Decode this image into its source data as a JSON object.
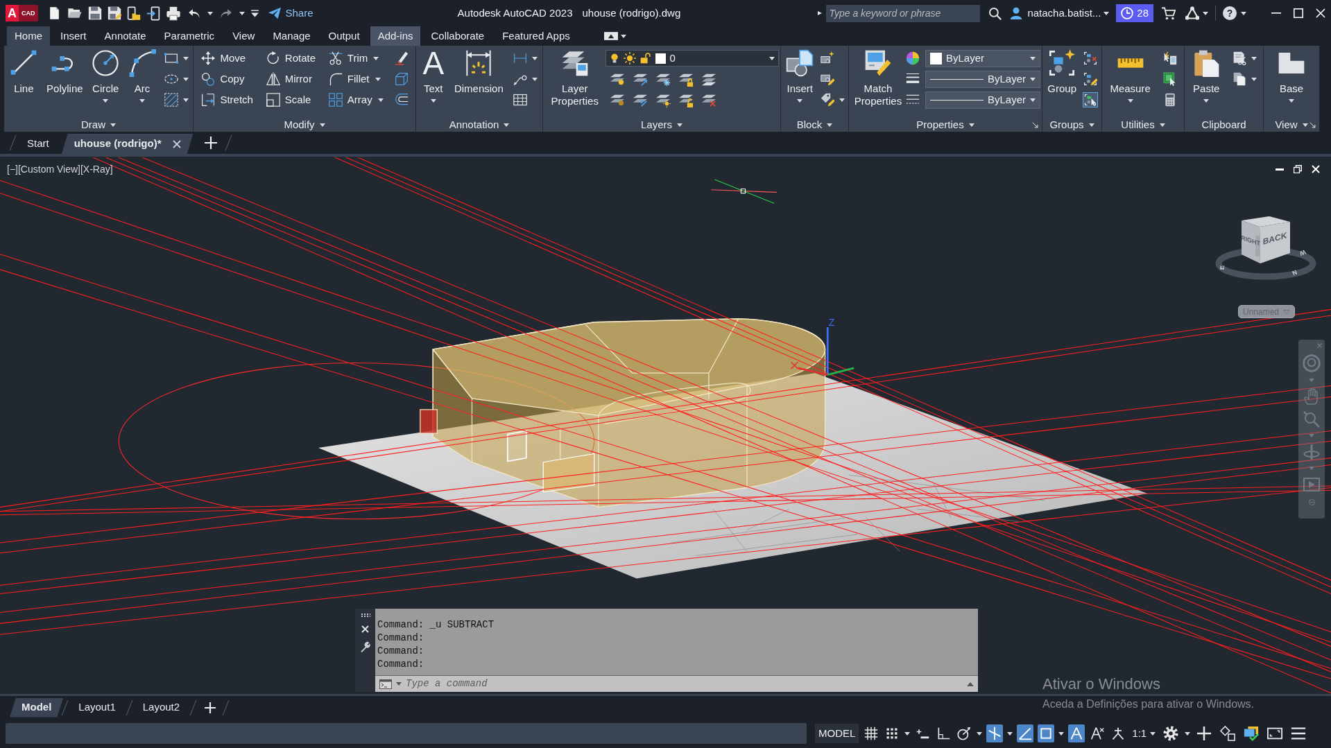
{
  "title_bar": {
    "logo": {
      "letter": "A",
      "text": "CAD"
    },
    "share": "Share",
    "title": "Autodesk AutoCAD 2023",
    "file": "uhouse (rodrigo).dwg",
    "search": {
      "placeholder": "Type a keyword or phrase"
    },
    "user": "natacha.batist...",
    "badge": "28",
    "help": "?"
  },
  "ribbon": {
    "tabs": [
      {
        "label": "Home",
        "selected": true,
        "highlighted": false
      },
      {
        "label": "Insert",
        "selected": false,
        "highlighted": false
      },
      {
        "label": "Annotate",
        "selected": false,
        "highlighted": false
      },
      {
        "label": "Parametric",
        "selected": false,
        "highlighted": false
      },
      {
        "label": "View",
        "selected": false,
        "highlighted": false
      },
      {
        "label": "Manage",
        "selected": false,
        "highlighted": false
      },
      {
        "label": "Output",
        "selected": false,
        "highlighted": false
      },
      {
        "label": "Add-ins",
        "selected": false,
        "highlighted": true
      },
      {
        "label": "Collaborate",
        "selected": false,
        "highlighted": false
      },
      {
        "label": "Featured Apps",
        "selected": false,
        "highlighted": false
      }
    ],
    "panels": [
      {
        "title": "Draw",
        "menu": true,
        "launcher": false,
        "columns": [
          {
            "kind": "large",
            "label": "Line",
            "dropdown": false
          },
          {
            "kind": "large",
            "label": "Polyline",
            "dropdown": false
          },
          {
            "kind": "large",
            "label": "Circle",
            "dropdown": true
          },
          {
            "kind": "large",
            "label": "Arc",
            "dropdown": true
          },
          {
            "kind": "small",
            "items": [
              {
                "dropdown": true
              },
              {
                "dropdown": true
              },
              {
                "dropdown": true
              }
            ]
          }
        ]
      },
      {
        "title": "Modify",
        "menu": true,
        "launcher": false,
        "columns": [
          {
            "kind": "small",
            "items": [
              {
                "label": "Move",
                "dropdown": false
              },
              {
                "label": "Copy",
                "dropdown": false
              },
              {
                "label": "Stretch",
                "dropdown": false
              }
            ]
          },
          {
            "kind": "small",
            "items": [
              {
                "label": "Rotate",
                "dropdown": false
              },
              {
                "label": "Mirror",
                "dropdown": false
              },
              {
                "label": "Scale",
                "dropdown": false
              }
            ]
          },
          {
            "kind": "small",
            "items": [
              {
                "label": "Trim",
                "dropdown": true
              },
              {
                "label": "Fillet",
                "dropdown": true
              },
              {
                "label": "Array",
                "dropdown": true
              }
            ]
          },
          {
            "kind": "small",
            "items": [
              {
                "dropdown": false
              },
              {
                "dropdown": false
              },
              {
                "dropdown": false
              }
            ]
          }
        ]
      },
      {
        "title": "Annotation",
        "menu": true,
        "launcher": false,
        "columns": [
          {
            "kind": "large",
            "label": "Text",
            "glyph": "A",
            "dropdown": true
          },
          {
            "kind": "large",
            "label": "Dimension",
            "dropdown": false
          },
          {
            "kind": "small",
            "items": [
              {
                "dropdown": true
              },
              {
                "dropdown": true
              },
              {
                "dropdown": false
              }
            ]
          }
        ]
      },
      {
        "title": "Layers",
        "menu": true,
        "launcher": false,
        "columns": [
          {
            "kind": "large",
            "label": "Layer Properties",
            "dropdown": false
          },
          {
            "kind": "layers",
            "value": "0"
          }
        ]
      },
      {
        "title": "Block",
        "menu": true,
        "launcher": false,
        "columns": [
          {
            "kind": "large",
            "label": "Insert",
            "dropdown": true
          },
          {
            "kind": "small",
            "items": [
              {
                "dropdown": false
              },
              {
                "dropdown": false
              },
              {
                "dropdown": true
              }
            ]
          }
        ]
      },
      {
        "title": "Properties",
        "menu": true,
        "launcher": true,
        "columns": [
          {
            "kind": "large",
            "label": "Match Properties",
            "dropdown": false
          },
          {
            "kind": "properties",
            "selects": [
              {
                "kind": "color",
                "value": "ByLayer"
              },
              {
                "kind": "line",
                "value": "ByLayer"
              },
              {
                "kind": "line",
                "value": "ByLayer"
              }
            ]
          }
        ]
      },
      {
        "title": "Groups",
        "menu": true,
        "launcher": false,
        "columns": [
          {
            "kind": "large",
            "label": "Group",
            "dropdown": false
          },
          {
            "kind": "small",
            "items": [
              {
                "dropdown": false,
                "on": false
              },
              {
                "dropdown": false,
                "on": false
              },
              {
                "dropdown": false,
                "on": true
              }
            ]
          }
        ]
      },
      {
        "title": "Utilities",
        "menu": true,
        "launcher": false,
        "columns": [
          {
            "kind": "large",
            "label": "Measure",
            "dropdown": true
          },
          {
            "kind": "small",
            "items": [
              {
                "dropdown": false
              },
              {
                "dropdown": false
              },
              {
                "dropdown": false
              }
            ]
          }
        ]
      },
      {
        "title": "Clipboard",
        "menu": false,
        "launcher": false,
        "columns": [
          {
            "kind": "large",
            "label": "Paste",
            "dropdown": true
          },
          {
            "kind": "small",
            "items": [
              {
                "dropdown": true
              },
              {
                "dropdown": true
              }
            ]
          }
        ]
      },
      {
        "title": "View",
        "menu": true,
        "launcher": true,
        "columns": [
          {
            "kind": "large",
            "label": "Base",
            "dropdown": true
          }
        ]
      }
    ]
  },
  "document_tabs": [
    {
      "label": "Start",
      "selected": false,
      "closable": false
    },
    {
      "label": "uhouse (rodrigo)*",
      "selected": true,
      "closable": true
    }
  ],
  "viewport": {
    "controls": [
      "[−]",
      "[Custom View]",
      "[X-Ray]"
    ],
    "viewcube": {
      "faces": [
        "RIGHT",
        "BACK"
      ],
      "compass": [
        "E",
        "N",
        "W"
      ]
    },
    "named_view": "Unnamed",
    "ucs_label": "Z"
  },
  "command_line": {
    "history": [
      "Command: _u SUBTRACT",
      "Command:",
      "Command:",
      "Command:"
    ],
    "placeholder": "Type a command"
  },
  "layout_tabs": [
    {
      "label": "Model",
      "selected": true
    },
    {
      "label": "Layout1",
      "selected": false
    },
    {
      "label": "Layout2",
      "selected": false
    }
  ],
  "windows_notice": {
    "title": "Ativar o Windows",
    "text": "Aceda a Definições para ativar o Windows."
  },
  "status_bar": {
    "space": "MODEL",
    "toggles": [
      {
        "on": false,
        "dropdown": false
      },
      {
        "on": false,
        "dropdown": true
      },
      {
        "on": false,
        "dropdown": false
      },
      {
        "on": false,
        "dropdown": false
      },
      {
        "on": false,
        "dropdown": true
      },
      {
        "on": true,
        "dropdown": true
      },
      {
        "on": true,
        "dropdown": false
      },
      {
        "on": true,
        "dropdown": true
      },
      {
        "on": true,
        "dropdown": false
      },
      {
        "on": false,
        "dropdown": false
      },
      {
        "on": false,
        "dropdown": false
      }
    ],
    "scale": "1:1",
    "buttons": [
      {
        "dropdown": true
      },
      {
        "dropdown": false
      },
      {
        "dropdown": false
      },
      {
        "dropdown": false
      },
      {
        "dropdown": false
      },
      {
        "dropdown": false
      }
    ]
  }
}
